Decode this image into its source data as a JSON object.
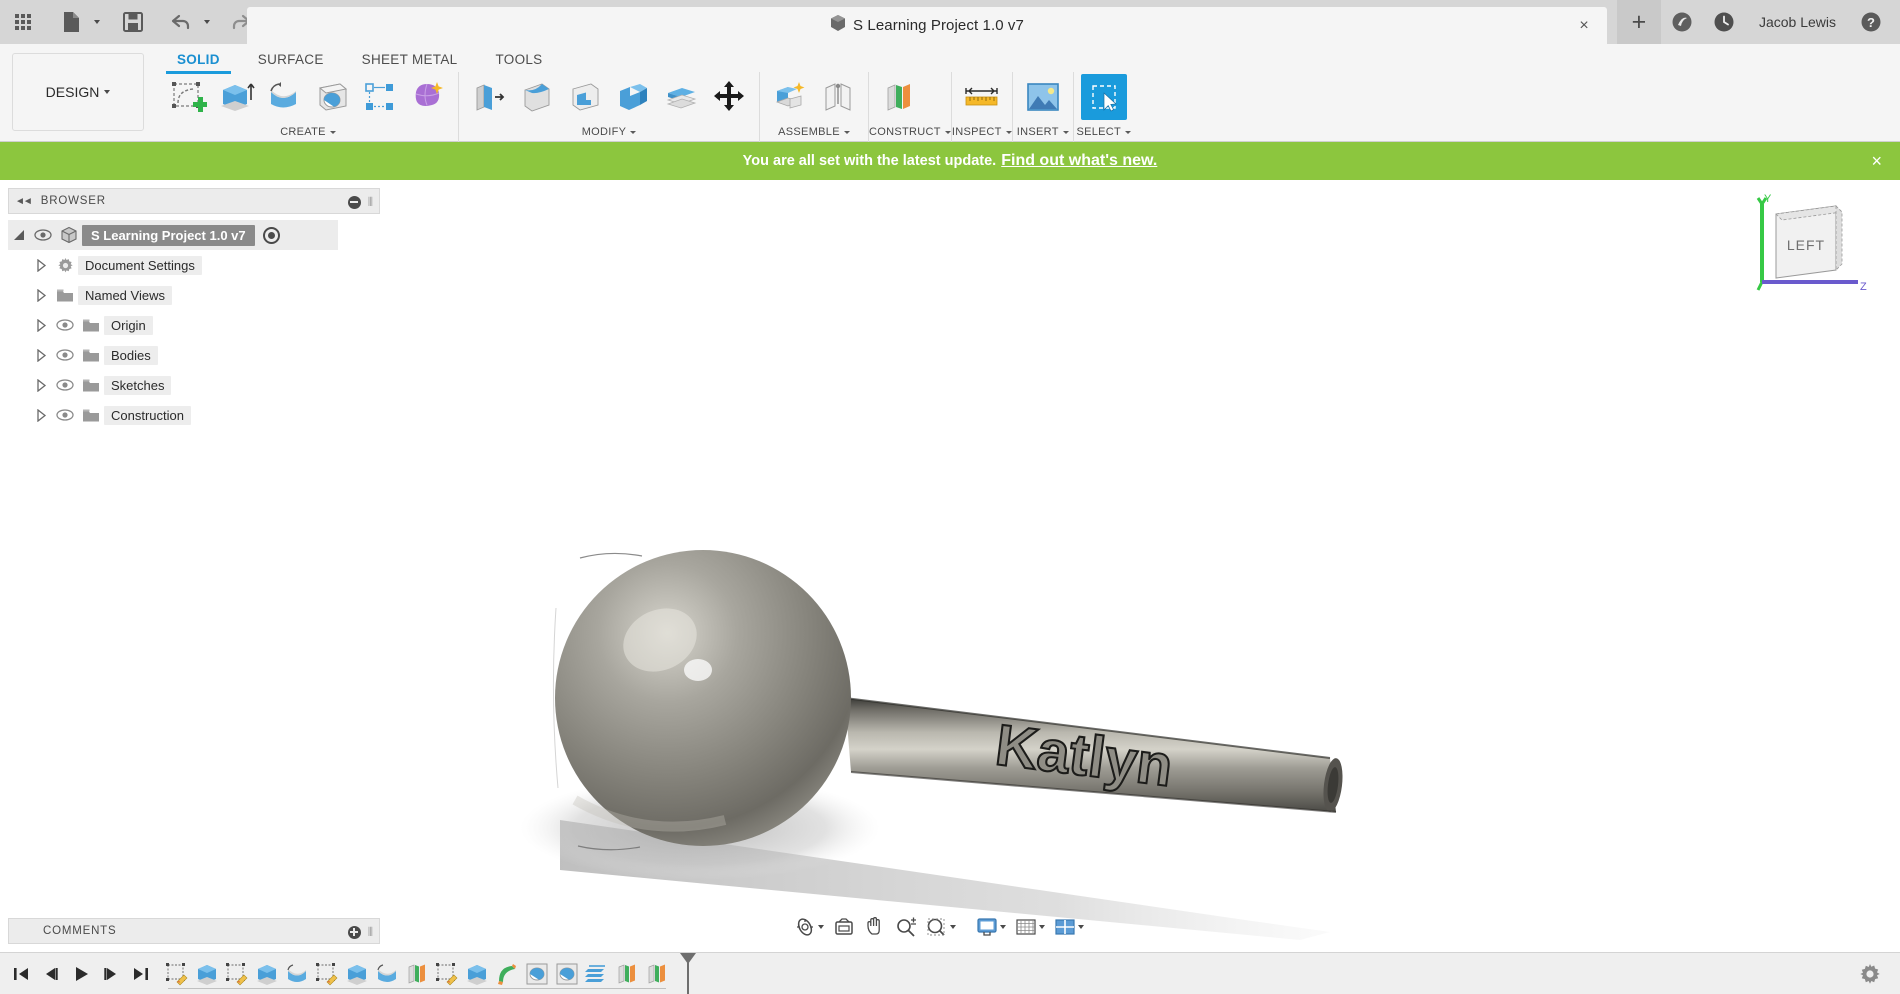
{
  "titlebar": {
    "apps_icon": "grid-apps-icon",
    "file_icon": "new-document-icon",
    "save_icon": "save-icon",
    "undo_icon": "undo-icon",
    "redo_icon": "redo-icon",
    "document_title": "S Learning Project 1.0 v7",
    "document_icon": "cube-icon",
    "close_tab_label": "×",
    "new_tab_label": "+",
    "job_status_icon": "job-status-icon",
    "recent_icon": "recent-clock-icon",
    "user_name": "Jacob Lewis",
    "help_icon": "help-icon"
  },
  "ribbon": {
    "workspace_label": "DESIGN",
    "tabs": [
      {
        "label": "SOLID",
        "active": true
      },
      {
        "label": "SURFACE",
        "active": false
      },
      {
        "label": "SHEET METAL",
        "active": false
      },
      {
        "label": "TOOLS",
        "active": false
      }
    ],
    "groups": [
      {
        "label": "CREATE",
        "commands": [
          {
            "name": "create-sketch-icon"
          },
          {
            "name": "extrude-icon"
          },
          {
            "name": "revolve-icon"
          },
          {
            "name": "hole-icon"
          },
          {
            "name": "pattern-icon"
          },
          {
            "name": "form-icon"
          }
        ]
      },
      {
        "label": "MODIFY",
        "commands": [
          {
            "name": "press-pull-icon"
          },
          {
            "name": "fillet-icon"
          },
          {
            "name": "shell-icon"
          },
          {
            "name": "combine-icon"
          },
          {
            "name": "offset-face-icon"
          },
          {
            "name": "move-copy-icon"
          }
        ]
      },
      {
        "label": "ASSEMBLE",
        "commands": [
          {
            "name": "new-component-icon"
          },
          {
            "name": "joint-icon"
          }
        ]
      },
      {
        "label": "CONSTRUCT",
        "commands": [
          {
            "name": "offset-plane-icon"
          }
        ]
      },
      {
        "label": "INSPECT",
        "commands": [
          {
            "name": "measure-icon"
          }
        ]
      },
      {
        "label": "INSERT",
        "commands": [
          {
            "name": "insert-image-icon"
          }
        ]
      },
      {
        "label": "SELECT",
        "commands": [
          {
            "name": "select-icon",
            "selected": true
          }
        ]
      }
    ]
  },
  "banner": {
    "message": "You are all set with the latest update.",
    "link": "Find out what's new.",
    "close_label": "×",
    "color": "#8cc63e"
  },
  "browser": {
    "title": "BROWSER",
    "collapse_icon": "collapse-left-icon",
    "options_icon": "minus-circle-icon",
    "grip_icon": "resize-grip-icon",
    "root": {
      "label": "S Learning Project 1.0 v7",
      "icon": "component-cube-icon",
      "visibility_icon": "eye-icon",
      "expand_icon": "expanded-triangle-icon",
      "activate_icon": "activate-radio-icon"
    },
    "items": [
      {
        "label": "Document Settings",
        "icon": "gear-icon",
        "has_eye": false
      },
      {
        "label": "Named Views",
        "icon": "folder-icon",
        "has_eye": false
      },
      {
        "label": "Origin",
        "icon": "folder-icon",
        "has_eye": true
      },
      {
        "label": "Bodies",
        "icon": "folder-icon",
        "has_eye": true
      },
      {
        "label": "Sketches",
        "icon": "folder-icon",
        "has_eye": true
      },
      {
        "label": "Construction",
        "icon": "folder-icon",
        "has_eye": true
      }
    ]
  },
  "comments": {
    "title": "COMMENTS",
    "add_icon": "plus-circle-icon",
    "grip_icon": "resize-grip-icon"
  },
  "viewcube": {
    "face_label": "LEFT",
    "axis_y": "Y",
    "axis_z": "Z",
    "axis_y_color": "#36c945",
    "axis_z_color": "#6a5acd"
  },
  "model": {
    "engraved_text": "Katlyn",
    "body_color": "#8f8d86",
    "description": "grey metallic sphere attached to a cylindrical rod with engraved name"
  },
  "navbar": {
    "items": [
      {
        "name": "orbit-icon",
        "caret": true
      },
      {
        "name": "look-at-icon",
        "caret": false
      },
      {
        "name": "pan-icon",
        "caret": false
      },
      {
        "name": "zoom-icon",
        "caret": false
      },
      {
        "name": "zoom-window-icon",
        "caret": true
      },
      {
        "name": "display-settings-icon",
        "caret": true
      },
      {
        "name": "grid-snaps-icon",
        "caret": true
      },
      {
        "name": "viewports-icon",
        "caret": true
      }
    ]
  },
  "timeline": {
    "playback": [
      {
        "name": "go-to-beginning-icon"
      },
      {
        "name": "step-back-icon"
      },
      {
        "name": "play-icon"
      },
      {
        "name": "step-forward-icon"
      },
      {
        "name": "go-to-end-icon"
      }
    ],
    "features": [
      {
        "name": "sketch-feature-icon",
        "type": "sketch"
      },
      {
        "name": "extrude-feature-icon",
        "type": "extrude"
      },
      {
        "name": "sketch-feature-icon",
        "type": "sketch"
      },
      {
        "name": "extrude-feature-icon",
        "type": "extrude"
      },
      {
        "name": "revolve-feature-icon",
        "type": "revolve"
      },
      {
        "name": "sketch-feature-icon",
        "type": "sketch"
      },
      {
        "name": "extrude-feature-icon",
        "type": "extrude"
      },
      {
        "name": "revolve-feature-icon",
        "type": "revolve"
      },
      {
        "name": "plane-feature-icon",
        "type": "plane"
      },
      {
        "name": "sketch-feature-icon",
        "type": "sketch"
      },
      {
        "name": "extrude-feature-icon",
        "type": "extrude"
      },
      {
        "name": "pipe-feature-icon",
        "type": "pipe"
      },
      {
        "name": "hole-feature-icon",
        "type": "hole"
      },
      {
        "name": "hole-feature-icon",
        "type": "hole"
      },
      {
        "name": "thread-feature-icon",
        "type": "thread"
      },
      {
        "name": "plane-feature-icon",
        "type": "plane"
      },
      {
        "name": "plane-feature-icon",
        "type": "plane"
      }
    ],
    "marker_name": "timeline-end-marker",
    "settings_icon": "gear-icon"
  }
}
